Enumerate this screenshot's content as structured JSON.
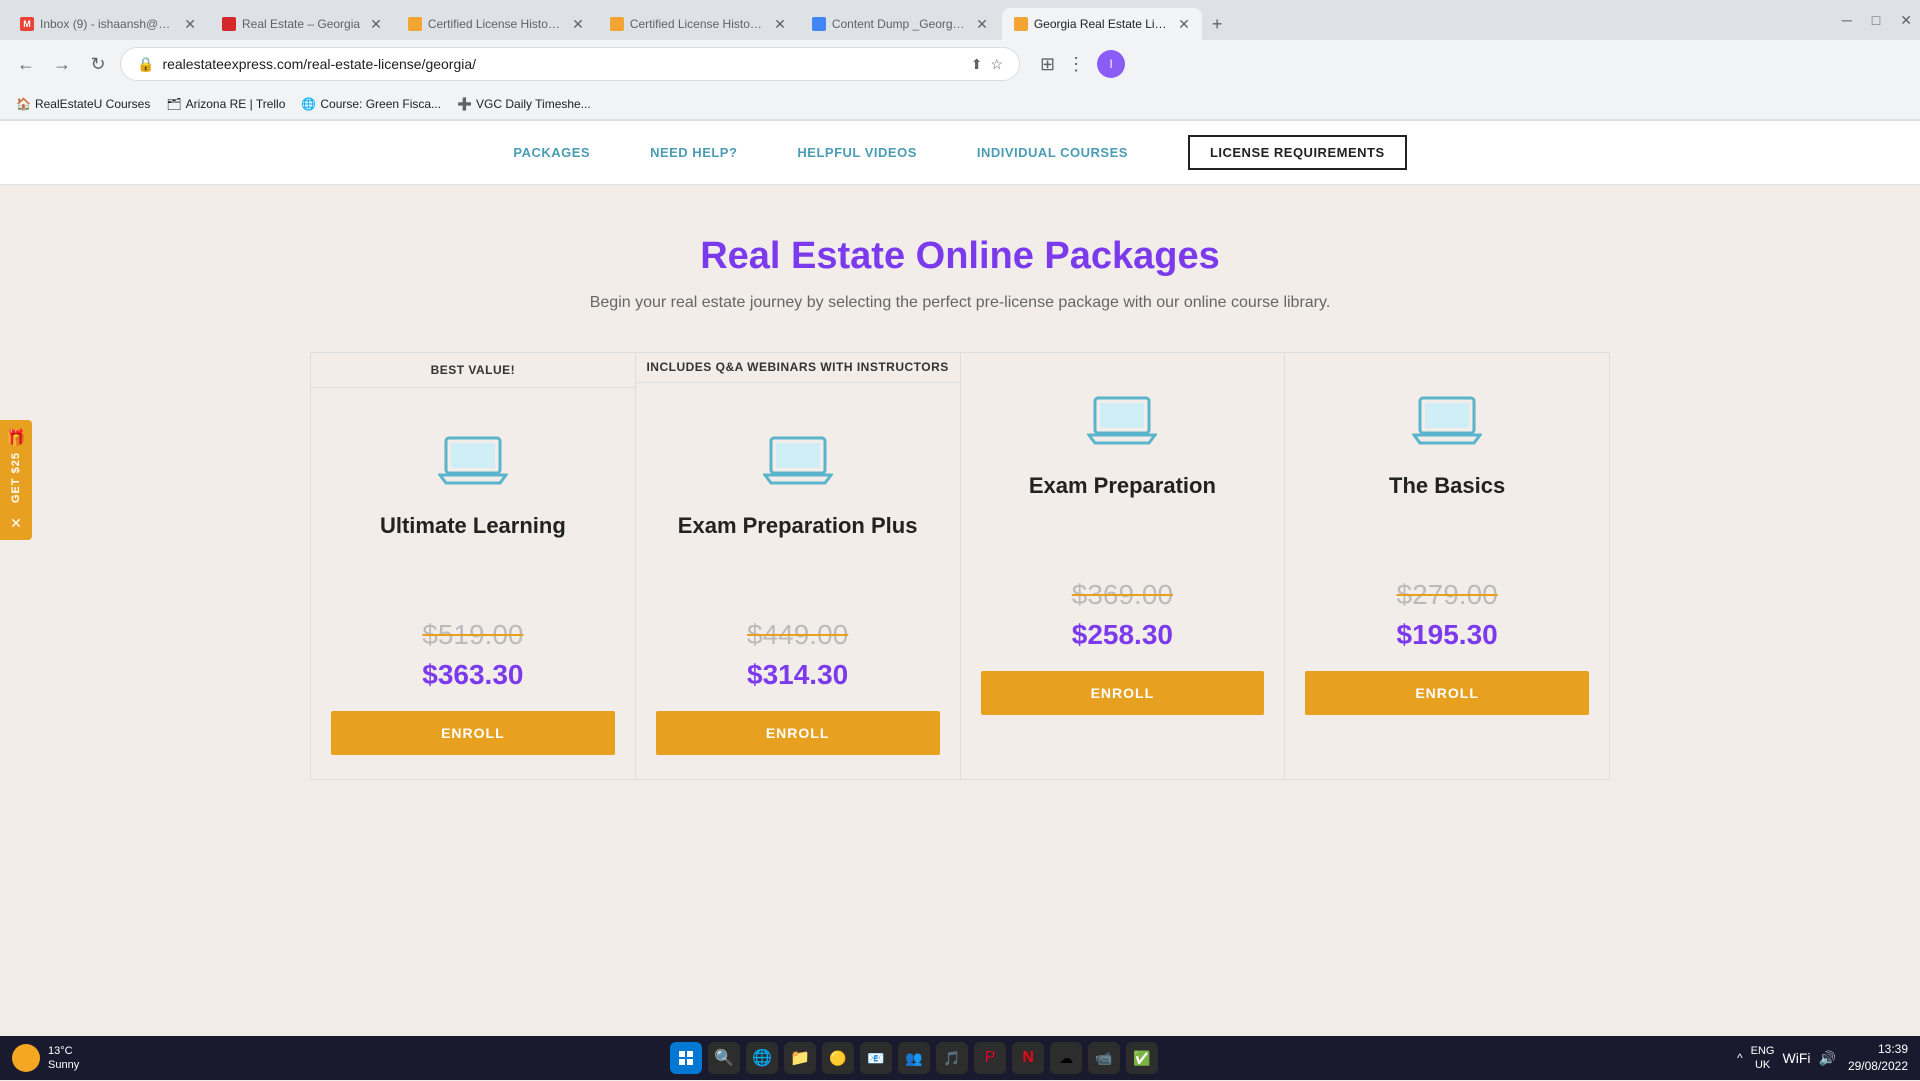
{
  "browser": {
    "tabs": [
      {
        "id": "gmail",
        "label": "Inbox (9) - ishaansh@vong...",
        "favicon_color": "#EA4335",
        "active": false
      },
      {
        "id": "realtor",
        "label": "Real Estate – Georgia",
        "favicon_color": "#D4262B",
        "active": false
      },
      {
        "id": "cert1",
        "label": "Certified License History O...",
        "favicon_color": "#F4A432",
        "active": false
      },
      {
        "id": "cert2",
        "label": "Certified License History O...",
        "favicon_color": "#F4A432",
        "active": false
      },
      {
        "id": "docs",
        "label": "Content Dump _Georgia.do...",
        "favicon_color": "#4285F4",
        "active": false
      },
      {
        "id": "active",
        "label": "Georgia Real Estate License...",
        "favicon_color": "#F4A432",
        "active": true
      }
    ],
    "url": "realestateexpress.com/real-estate-license/georgia/",
    "bookmarks": [
      {
        "label": "RealEstateU Courses"
      },
      {
        "label": "Arizona RE | Trello"
      },
      {
        "label": "Course: Green Fisca..."
      },
      {
        "label": "VGC Daily Timeshe..."
      }
    ]
  },
  "nav": {
    "items": [
      {
        "label": "PACKAGES",
        "active": false
      },
      {
        "label": "NEED HELP?",
        "active": false
      },
      {
        "label": "HELPFUL VIDEOS",
        "active": false
      },
      {
        "label": "INDIVIDUAL COURSES",
        "active": false
      },
      {
        "label": "LICENSE REQUIREMENTS",
        "active": true
      }
    ]
  },
  "hero": {
    "title": "Real Estate Online Packages",
    "subtitle": "Begin your real estate journey by selecting the perfect pre-license package with our online course library."
  },
  "packages": [
    {
      "id": "ultimate",
      "badge": "BEST VALUE!",
      "badge_lines": 1,
      "name": "Ultimate Learning",
      "original_price": "$519.00",
      "sale_price": "$363.30",
      "enroll_label": "ENROLL"
    },
    {
      "id": "exam-plus",
      "badge": "INCLUDES Q&A WEBINARS WITH INSTRUCTORS",
      "badge_lines": 2,
      "name": "Exam Preparation Plus",
      "original_price": "$449.00",
      "sale_price": "$314.30",
      "enroll_label": "ENROLL"
    },
    {
      "id": "exam",
      "badge": "",
      "badge_lines": 0,
      "name": "Exam Preparation",
      "original_price": "$369.00",
      "sale_price": "$258.30",
      "enroll_label": "ENROLL"
    },
    {
      "id": "basics",
      "badge": "",
      "badge_lines": 0,
      "name": "The Basics",
      "original_price": "$279.00",
      "sale_price": "$195.30",
      "enroll_label": "ENROLL"
    }
  ],
  "side_widget": {
    "text": "GET $25",
    "close": "✕"
  },
  "taskbar": {
    "weather_temp": "13°C",
    "weather_desc": "Sunny",
    "clock_time": "13:39",
    "clock_date": "29/08/2022",
    "locale": "ENG\nUK"
  }
}
